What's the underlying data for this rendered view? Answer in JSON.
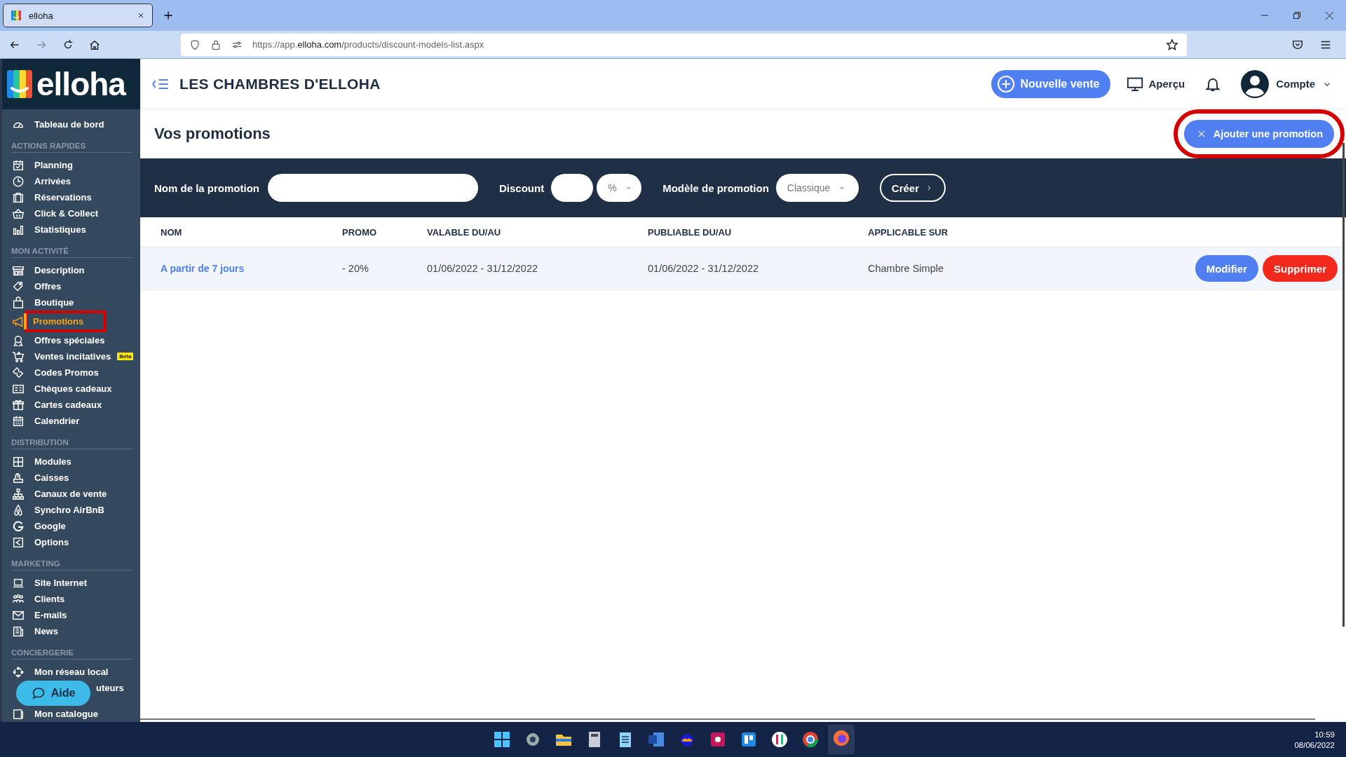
{
  "browser": {
    "tab": {
      "title": "elloha",
      "selected": true
    },
    "url": {
      "prefix": "https://app.",
      "domain": "elloha.com",
      "path": "/products/discount-models-list.aspx"
    }
  },
  "logo": "elloha",
  "sidebar": {
    "top_item": {
      "label": "Tableau de bord",
      "selected": false
    },
    "sections": [
      {
        "title": "ACTIONS RAPIDES",
        "items": [
          {
            "label": "Planning",
            "selected": false
          },
          {
            "label": "Arrivées",
            "selected": false
          },
          {
            "label": "Réservations",
            "selected": false
          },
          {
            "label": "Click & Collect",
            "selected": false
          },
          {
            "label": "Statistiques",
            "selected": false
          }
        ]
      },
      {
        "title": "MON ACTIVITÉ",
        "items": [
          {
            "label": "Description",
            "selected": false
          },
          {
            "label": "Offres",
            "selected": false
          },
          {
            "label": "Boutique",
            "selected": false
          },
          {
            "label": "Promotions",
            "selected": true,
            "highlighted": true
          },
          {
            "label": "Offres spéciales",
            "selected": false
          },
          {
            "label": "Ventes incitatives",
            "selected": false,
            "badge": "Beta"
          },
          {
            "label": "Codes Promos",
            "selected": false
          },
          {
            "label": "Chèques cadeaux",
            "selected": false
          },
          {
            "label": "Cartes cadeaux",
            "selected": false
          },
          {
            "label": "Calendrier",
            "selected": false
          }
        ]
      },
      {
        "title": "DISTRIBUTION",
        "items": [
          {
            "label": "Modules",
            "selected": false
          },
          {
            "label": "Caisses",
            "selected": false
          },
          {
            "label": "Canaux de vente",
            "selected": false
          },
          {
            "label": "Synchro AirBnB",
            "selected": false
          },
          {
            "label": "Google",
            "selected": false
          },
          {
            "label": "Options",
            "selected": false
          }
        ]
      },
      {
        "title": "MARKETING",
        "items": [
          {
            "label": "Site Internet",
            "selected": false
          },
          {
            "label": "Clients",
            "selected": false
          },
          {
            "label": "E-mails",
            "selected": false
          },
          {
            "label": "News",
            "selected": false
          }
        ]
      },
      {
        "title": "CONCIERGERIE",
        "items": [
          {
            "label": "Mon réseau local",
            "selected": false
          },
          {
            "label": "uteurs",
            "selected": false
          },
          {
            "label": "Mon catalogue",
            "selected": false
          }
        ]
      }
    ]
  },
  "help_button": "Aide",
  "header": {
    "property": "LES CHAMBRES D'ELLOHA",
    "new_sale": "Nouvelle vente",
    "preview": "Aperçu",
    "account": "Compte"
  },
  "page": {
    "title": "Vos promotions",
    "add_button": {
      "label": "Ajouter une promotion",
      "highlighted": true
    }
  },
  "filters": {
    "name_label": "Nom de la promotion",
    "discount_label": "Discount",
    "unit": "%",
    "model_label": "Modèle de promotion",
    "model": "Classique",
    "create_button": "Créer"
  },
  "table": {
    "columns": [
      "NOM",
      "PROMO",
      "VALABLE DU/AU",
      "PUBLIABLE DU/AU",
      "APPLICABLE SUR"
    ],
    "rows": [
      {
        "name": "A partir de 7 jours",
        "promo": "- 20%",
        "valid": "01/06/2022 - 31/12/2022",
        "publishable": "01/06/2022 - 31/12/2022",
        "applies_to": "Chambre Simple",
        "actions": [
          "Modifier",
          "Supprimer"
        ]
      }
    ]
  },
  "taskbar": {
    "time": "10:59",
    "date": "08/06/2022"
  }
}
